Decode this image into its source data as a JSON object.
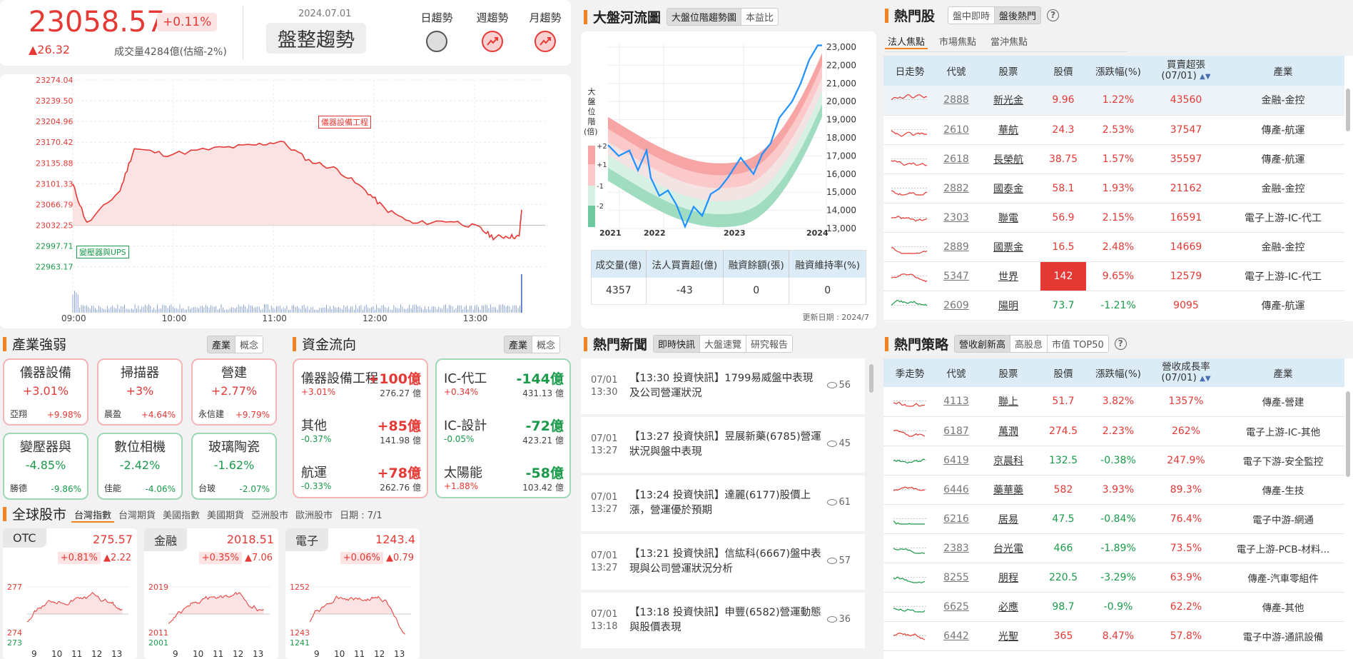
{
  "index": {
    "value": "23058.57",
    "change_pct": "+0.11%",
    "change": "▲26.32",
    "volume": "成交量4284億(估縮-2%)",
    "date": "2024.07.01",
    "trend": "盤整趨勢",
    "trends": [
      {
        "label": "日趨勢"
      },
      {
        "label": "週趨勢"
      },
      {
        "label": "月趨勢"
      }
    ]
  },
  "intraday": {
    "y_ticks": [
      "23274.04",
      "23239.50",
      "23204.96",
      "23170.42",
      "23135.88",
      "23101.33",
      "23066.79",
      "23032.25",
      "22997.71",
      "22963.17"
    ],
    "x_ticks": [
      "09:00",
      "10:00",
      "11:00",
      "12:00",
      "13:00"
    ],
    "annot_top": "儀器設備工程",
    "annot_bottom": "變壓器與UPS"
  },
  "chart_data": {
    "type": "line",
    "x": [
      "09:00",
      "09:30",
      "10:00",
      "10:30",
      "11:00",
      "11:30",
      "12:00",
      "12:30",
      "13:00",
      "13:25"
    ],
    "series": [
      {
        "values": [
          23101,
          23080,
          23150,
          23160,
          23165,
          23172,
          23120,
          23055,
          23030,
          23058
        ]
      }
    ],
    "ylim": [
      22963.17,
      23274.04
    ]
  },
  "river": {
    "title": "大盤河流圖",
    "tabs": [
      "大盤位階趨勢圖",
      "本益比"
    ],
    "ylabel": [
      "大",
      "盤",
      "位",
      "階",
      "(倍)"
    ],
    "bands": [
      "+2",
      "+1",
      "-1",
      "-2"
    ],
    "y_ticks": [
      "23,000",
      "22,000",
      "21,000",
      "20,000",
      "19,000",
      "18,000",
      "17,000",
      "16,000",
      "15,000",
      "14,000",
      "13,000"
    ],
    "x_ticks": [
      "2021",
      "2022",
      "2023",
      "2024"
    ],
    "table_headers": [
      "成交量(億)",
      "法人買賣超(億)",
      "融資餘額(張)",
      "融資維持率(%)"
    ],
    "table_values": [
      "4357",
      "-43",
      "0",
      "0"
    ],
    "update": "更新日期 : 2024/7"
  },
  "hot": {
    "title": "熱門股",
    "tabs": [
      "盤中即時",
      "盤後熱門"
    ],
    "subtabs": [
      "法人焦點",
      "市場焦點",
      "當沖焦點"
    ],
    "headers": [
      "日走勢",
      "代號",
      "股票",
      "股價",
      "漲跌幅(%)",
      "買賣超張\n(07/01)",
      "產業"
    ],
    "rows": [
      {
        "code": "2888",
        "name": "新光金",
        "price": "9.96",
        "chg": "1.22%",
        "net": "43560",
        "ind": "金融-金控",
        "c": "red"
      },
      {
        "code": "2610",
        "name": "華航",
        "price": "24.3",
        "chg": "2.53%",
        "net": "37547",
        "ind": "傳產-航運",
        "c": "red"
      },
      {
        "code": "2618",
        "name": "長榮航",
        "price": "38.75",
        "chg": "1.57%",
        "net": "35597",
        "ind": "傳產-航運",
        "c": "red"
      },
      {
        "code": "2882",
        "name": "國泰金",
        "price": "58.1",
        "chg": "1.93%",
        "net": "21162",
        "ind": "金融-金控",
        "c": "red"
      },
      {
        "code": "2303",
        "name": "聯電",
        "price": "56.9",
        "chg": "2.15%",
        "net": "16591",
        "ind": "電子上游-IC-代工",
        "c": "red"
      },
      {
        "code": "2889",
        "name": "國票金",
        "price": "16.5",
        "chg": "2.48%",
        "net": "14669",
        "ind": "金融-金控",
        "c": "red"
      },
      {
        "code": "5347",
        "name": "世界",
        "price": "142",
        "chg": "9.65%",
        "net": "12579",
        "ind": "電子上游-IC-代工",
        "c": "red"
      },
      {
        "code": "2609",
        "name": "陽明",
        "price": "73.7",
        "chg": "-1.21%",
        "net": "9095",
        "ind": "傳產-航運",
        "c": "green"
      }
    ]
  },
  "industry": {
    "title": "產業強弱",
    "tabs": [
      "產業",
      "概念"
    ],
    "items": [
      {
        "name": "儀器設備",
        "pct": "+3.01%",
        "stock": "亞翔",
        "spct": "+9.98%",
        "c": "red"
      },
      {
        "name": "掃描器",
        "pct": "+3%",
        "stock": "晨盈",
        "spct": "+4.64%",
        "c": "red"
      },
      {
        "name": "營建",
        "pct": "+2.77%",
        "stock": "永信建",
        "spct": "+9.79%",
        "c": "red"
      },
      {
        "name": "變壓器與",
        "pct": "-4.85%",
        "stock": "勝德",
        "spct": "-9.86%",
        "c": "green"
      },
      {
        "name": "數位相機",
        "pct": "-2.42%",
        "stock": "佳能",
        "spct": "-4.06%",
        "c": "green"
      },
      {
        "name": "玻璃陶瓷",
        "pct": "-1.62%",
        "stock": "台玻",
        "spct": "-2.07%",
        "c": "green"
      }
    ]
  },
  "flow": {
    "title": "資金流向",
    "tabs": [
      "產業",
      "概念"
    ],
    "inflow": [
      {
        "name": "儀器設備工程",
        "val": "+100億",
        "pct": "+3.01%",
        "amt": "276.27 億"
      },
      {
        "name": "其他",
        "val": "+85億",
        "pct": "-0.37%",
        "amt": "141.98 億"
      },
      {
        "name": "航運",
        "val": "+78億",
        "pct": "-0.33%",
        "amt": "262.76 億"
      }
    ],
    "outflow": [
      {
        "name": "IC-代工",
        "val": "-144億",
        "pct": "+0.34%",
        "amt": "431.13 億"
      },
      {
        "name": "IC-設計",
        "val": "-72億",
        "pct": "-0.05%",
        "amt": "423.21 億"
      },
      {
        "name": "太陽能",
        "val": "-58億",
        "pct": "+1.88%",
        "amt": "103.42 億"
      }
    ]
  },
  "global": {
    "title": "全球股市",
    "tabs": [
      "台灣指數",
      "台灣期貨",
      "美國指數",
      "美國期貨",
      "亞洲股市",
      "歐洲股市"
    ],
    "date": "日期 : 7/1",
    "cards": [
      {
        "name": "OTC",
        "price": "275.57",
        "pct": "+0.81%",
        "chg": "▲2.22",
        "yt": [
          "277",
          "274"
        ],
        "yb": "273"
      },
      {
        "name": "金融",
        "price": "2018.51",
        "pct": "+0.35%",
        "chg": "▲7.06",
        "yt": [
          "2019",
          "2011"
        ],
        "yb": "2001"
      },
      {
        "name": "電子",
        "price": "1243.4",
        "pct": "+0.06%",
        "chg": "▲0.79",
        "yt": [
          "1252",
          "1243"
        ],
        "yb": "1241"
      }
    ],
    "x_ticks": [
      "9",
      "10",
      "11",
      "12",
      "13"
    ]
  },
  "news": {
    "title": "熱門新聞",
    "tabs": [
      "即時快訊",
      "大盤速覽",
      "研究報告"
    ],
    "items": [
      {
        "date": "07/01",
        "time": "13:30",
        "title": "【13:30 投資快訊】1799易威盤中表現及公司營運狀況",
        "views": "56"
      },
      {
        "date": "07/01",
        "time": "13:27",
        "title": "【13:27 投資快訊】昱展新藥(6785)營運狀況與盤中表現",
        "views": "45"
      },
      {
        "date": "07/01",
        "time": "13:27",
        "title": "【13:24 投資快訊】達麗(6177)股價上漲，營運優於預期",
        "views": "61"
      },
      {
        "date": "07/01",
        "time": "13:27",
        "title": "【13:21 投資快訊】信紘科(6667)盤中表現與公司營運狀況分析",
        "views": "57"
      },
      {
        "date": "07/01",
        "time": "13:18",
        "title": "【13:18 投資快訊】申豐(6582)營運動態與股價表現",
        "views": "36"
      }
    ]
  },
  "strategy": {
    "title": "熱門策略",
    "tabs": [
      "營收創新高",
      "高股息",
      "市值 TOP50"
    ],
    "headers": [
      "季走勢",
      "代號",
      "股票",
      "股價",
      "漲跌幅(%)",
      "營收成長率\n(07/01)",
      "產業"
    ],
    "rows": [
      {
        "code": "4113",
        "name": "聯上",
        "price": "51.7",
        "chg": "3.82%",
        "rate": "1357%",
        "ind": "傳產-營建",
        "c": "red"
      },
      {
        "code": "6187",
        "name": "萬潤",
        "price": "274.5",
        "chg": "2.23%",
        "rate": "262%",
        "ind": "電子上游-IC-其他",
        "c": "red"
      },
      {
        "code": "6419",
        "name": "京晨科",
        "price": "132.5",
        "chg": "-0.38%",
        "rate": "247.9%",
        "ind": "電子下游-安全監控",
        "c": "green"
      },
      {
        "code": "6446",
        "name": "藥華藥",
        "price": "582",
        "chg": "3.93%",
        "rate": "89.3%",
        "ind": "傳產-生技",
        "c": "red"
      },
      {
        "code": "6216",
        "name": "居易",
        "price": "47.5",
        "chg": "-0.84%",
        "rate": "76.4%",
        "ind": "電子中游-網通",
        "c": "green"
      },
      {
        "code": "2383",
        "name": "台光電",
        "price": "466",
        "chg": "-1.89%",
        "rate": "73.5%",
        "ind": "電子上游-PCB-材料...",
        "c": "green"
      },
      {
        "code": "8255",
        "name": "朋程",
        "price": "220.5",
        "chg": "-3.29%",
        "rate": "63.9%",
        "ind": "傳產-汽車零組件",
        "c": "green"
      },
      {
        "code": "6625",
        "name": "必應",
        "price": "98.7",
        "chg": "-0.9%",
        "rate": "62.2%",
        "ind": "傳產-其他",
        "c": "green"
      },
      {
        "code": "6442",
        "name": "光聖",
        "price": "365",
        "chg": "8.47%",
        "rate": "57.8%",
        "ind": "電子中游-通訊設備",
        "c": "red"
      }
    ]
  }
}
